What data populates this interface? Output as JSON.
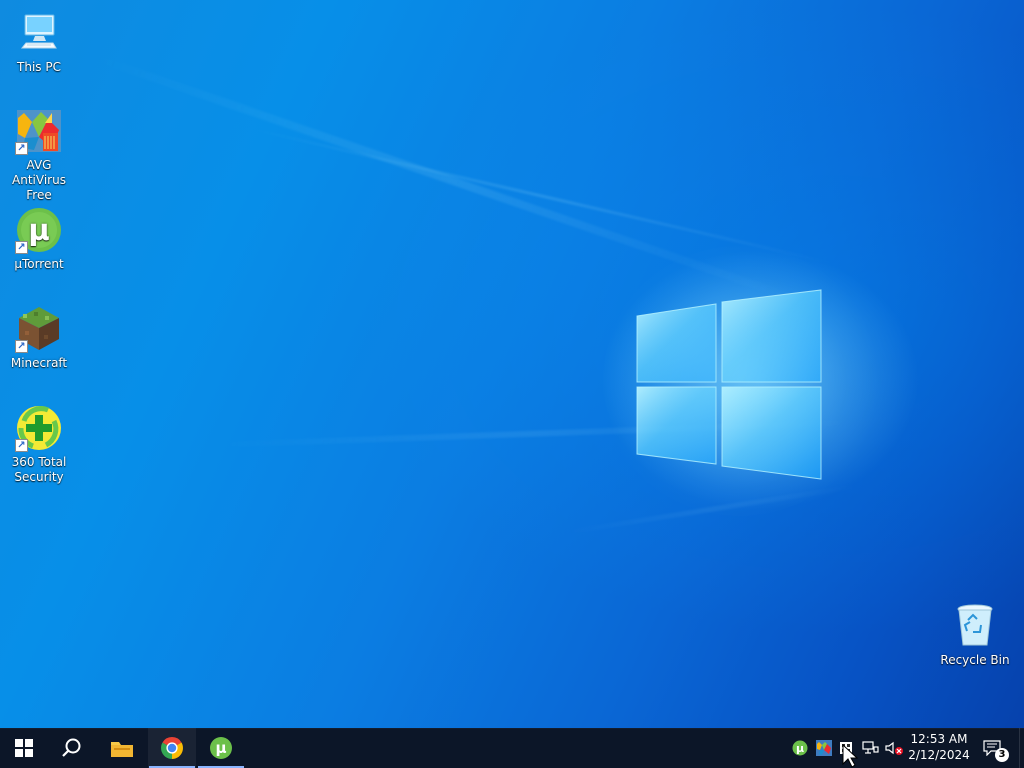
{
  "desktop": {
    "icons": [
      {
        "label": "This PC",
        "icon": "computer-icon"
      },
      {
        "label": "AVG AntiVirus Free",
        "icon": "avg-antivirus-icon"
      },
      {
        "label": "µTorrent",
        "icon": "utorrent-icon"
      },
      {
        "label": "Minecraft",
        "icon": "minecraft-icon"
      },
      {
        "label": "360 Total Security",
        "icon": "360-total-security-icon"
      },
      {
        "label": "Recycle Bin",
        "icon": "recycle-bin-icon"
      }
    ]
  },
  "taskbar": {
    "buttons": [
      {
        "icon": "windows-start-icon"
      },
      {
        "icon": "search-icon"
      },
      {
        "icon": "file-explorer-icon"
      },
      {
        "icon": "chrome-icon"
      },
      {
        "icon": "utorrent-icon"
      }
    ],
    "tray": {
      "time": "12:53 AM",
      "date": "2/12/2024",
      "notification_count": "3",
      "icons": [
        {
          "icon": "utorrent-tray-icon"
        },
        {
          "icon": "avg-tray-icon"
        },
        {
          "icon": "tray-app-icon"
        },
        {
          "icon": "network-icon"
        },
        {
          "icon": "volume-muted-icon"
        },
        {
          "icon": "action-center-icon"
        }
      ]
    }
  },
  "colors": {
    "desktop_blue": "#0a77df",
    "taskbar_bg": "#0c1628",
    "taskbar_active_underline": "#8ab4ff"
  }
}
